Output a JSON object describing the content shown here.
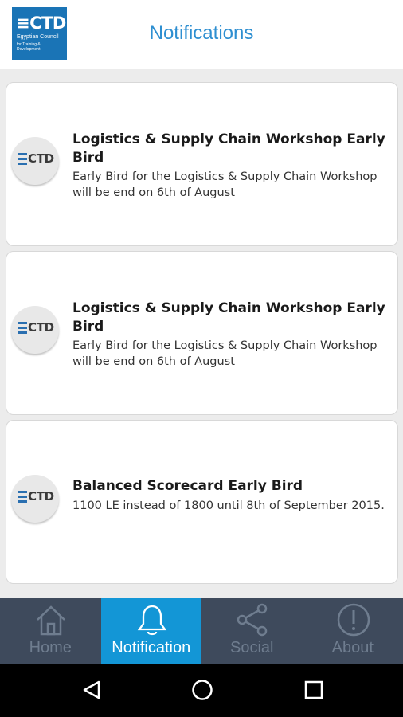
{
  "header": {
    "logo": {
      "mark": "CTD",
      "line1": "Egyptian Council",
      "line2": "for Training & Development"
    },
    "title": "Notifications"
  },
  "notifications": [
    {
      "avatar_text": "CTD",
      "title": "Logistics & Supply Chain Workshop Early Bird",
      "body": "Early Bird for the Logistics & Supply Chain Workshop will be end on 6th of August"
    },
    {
      "avatar_text": "CTD",
      "title": "Logistics & Supply Chain Workshop Early Bird",
      "body": "Early Bird for the Logistics & Supply Chain Workshop will be end on 6th of August"
    },
    {
      "avatar_text": "CTD",
      "title": "Balanced Scorecard Early Bird",
      "body": "1100 LE instead of 1800 until 8th of September 2015."
    }
  ],
  "tabs": [
    {
      "label": "Home",
      "icon": "home-icon",
      "active": false
    },
    {
      "label": "Notification",
      "icon": "bell-icon",
      "active": true
    },
    {
      "label": "Social",
      "icon": "share-icon",
      "active": false
    },
    {
      "label": "About",
      "icon": "info-icon",
      "active": false
    }
  ],
  "system_nav": [
    "back-icon",
    "home-circle-icon",
    "recents-icon"
  ],
  "colors": {
    "accent": "#1396d6",
    "title": "#2e8fd1",
    "tabbar": "#3e4a5c",
    "logo": "#1a74b6"
  }
}
